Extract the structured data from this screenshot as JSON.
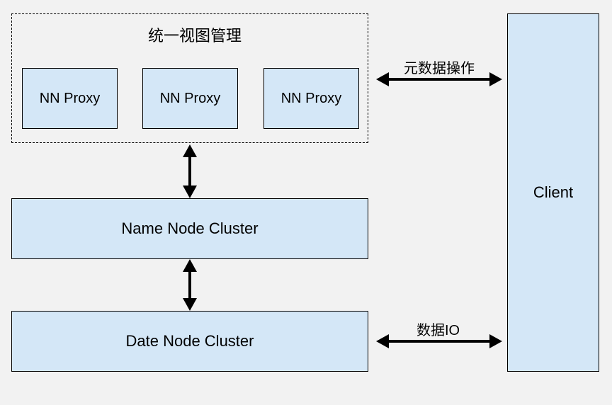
{
  "diagram": {
    "view_manager_title": "统一视图管理",
    "nn_proxy_1": "NN Proxy",
    "nn_proxy_2": "NN Proxy",
    "nn_proxy_3": "NN Proxy",
    "name_node_cluster": "Name Node Cluster",
    "date_node_cluster": "Date Node Cluster",
    "client": "Client",
    "metadata_operation_label": "元数据操作",
    "data_io_label": "数据IO"
  }
}
